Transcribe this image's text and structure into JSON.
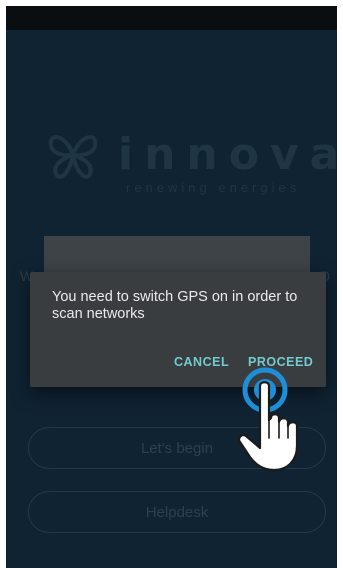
{
  "background": {
    "peek_left": "W",
    "peek_right": "D",
    "buttons": {
      "begin_label": "Let's begin",
      "helpdesk_label": "Helpdesk"
    }
  },
  "logo": {
    "wordmark": "innova",
    "tagline": "renewing energies"
  },
  "dialog": {
    "message": "You need to switch GPS on in order to scan networks",
    "cancel_label": "CANCEL",
    "proceed_label": "PROCEED"
  },
  "colors": {
    "accent": "#73cbcf",
    "tap_indicator": "#1e8fd6",
    "dialog_bg": "#3a3d40",
    "screen_bg": "#0f2333"
  },
  "icons": {
    "logo_mark": "butterfly-icon",
    "pointer": "hand-pointer-icon",
    "tap": "tap-indicator-icon"
  }
}
